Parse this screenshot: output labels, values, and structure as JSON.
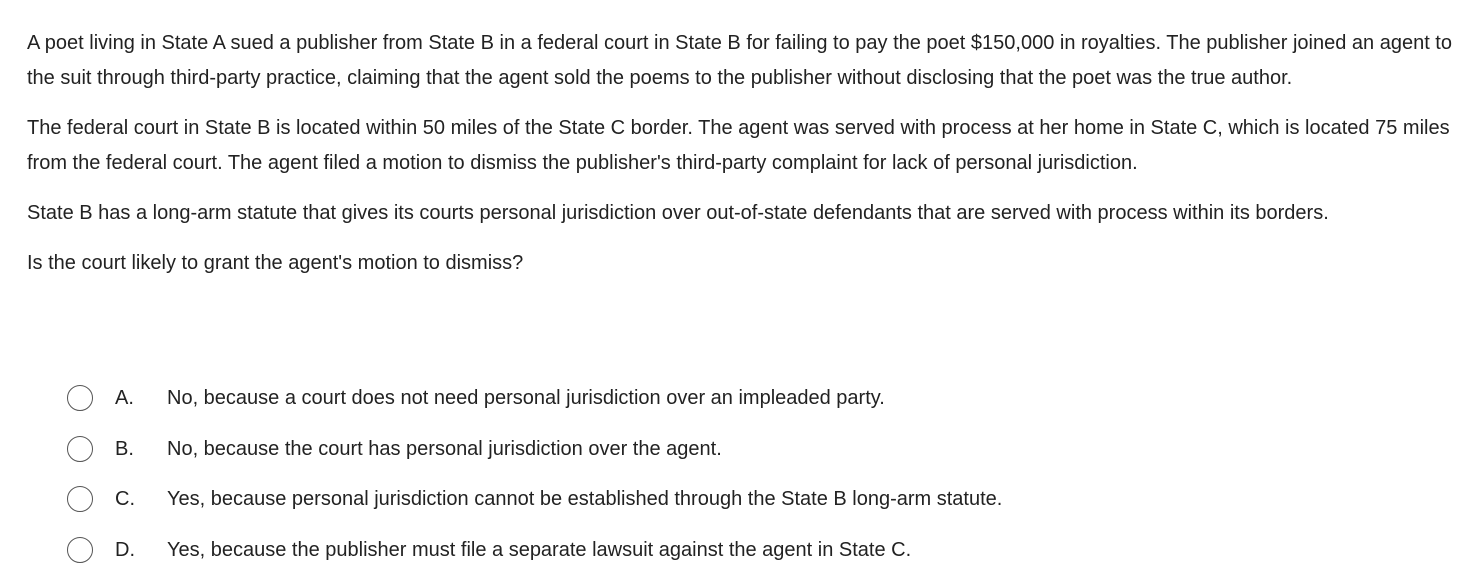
{
  "question": {
    "paragraphs": [
      "A poet living in State A sued a publisher from State B in a federal court in State B for failing to pay the poet $150,000 in royalties.  The publisher joined an agent to the suit through third-party practice, claiming that the agent sold the poems to the publisher without disclosing that the poet was the true author.",
      "The federal court in State B is located within 50 miles of the State C border.  The agent was served with process at her home in State C, which is located 75 miles from the federal court.  The agent filed a motion to dismiss the publisher's third-party complaint for lack of personal jurisdiction.",
      "State B has a long-arm statute that gives its courts personal jurisdiction over out-of-state defendants that are served with process within its borders.",
      "Is the court likely to grant the agent's motion to dismiss?"
    ]
  },
  "options": [
    {
      "letter": "A.",
      "text": "No, because a court does not need personal jurisdiction over an impleaded party."
    },
    {
      "letter": "B.",
      "text": "No, because the court has personal jurisdiction over the agent."
    },
    {
      "letter": "C.",
      "text": "Yes, because personal jurisdiction cannot be established through the State B long-arm statute."
    },
    {
      "letter": "D.",
      "text": "Yes, because the publisher must file a separate lawsuit against the agent in State C."
    }
  ]
}
